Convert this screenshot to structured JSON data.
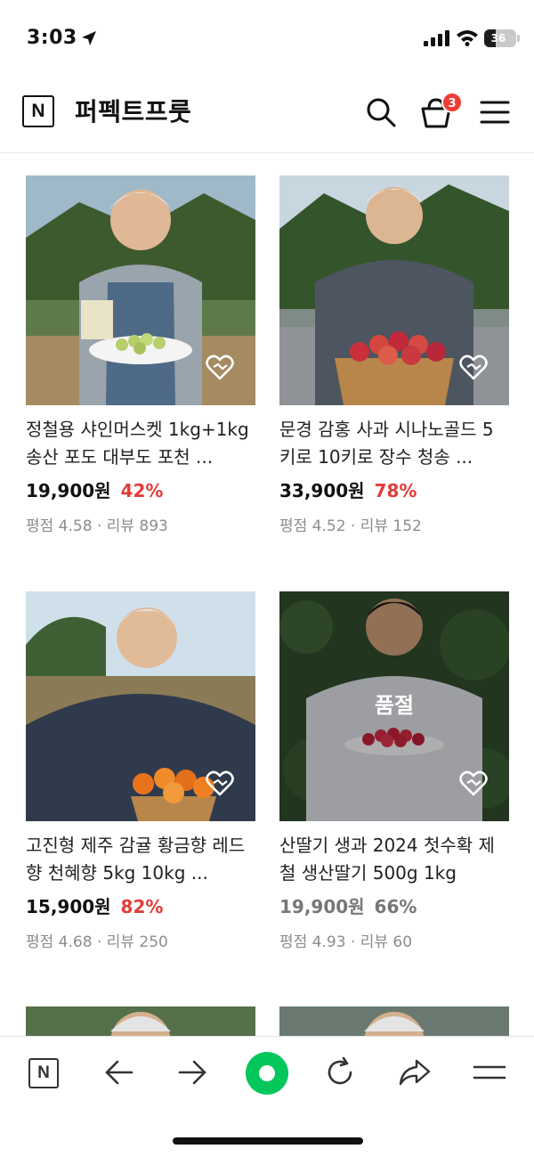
{
  "status_bar": {
    "time": "3:03",
    "battery": "36",
    "battery_level": 0.36
  },
  "header": {
    "logo": "N",
    "store_name": "퍼펙트프룻",
    "cart_count": "3"
  },
  "products": [
    {
      "title": "정철용 샤인머스켓 1kg+1kg 송산 포도 대부도 포천 ...",
      "price": "19,900원",
      "discount": "42%",
      "rating_review": "평점 4.58 · 리뷰 893",
      "sold_out": false
    },
    {
      "title": "문경 감홍 사과 시나노골드 5키로 10키로 장수 청송 ...",
      "price": "33,900원",
      "discount": "78%",
      "rating_review": "평점 4.52 · 리뷰 152",
      "sold_out": false
    },
    {
      "title": "고진형 제주 감귤 황금향 레드향 천혜향 5kg 10kg ...",
      "price": "15,900원",
      "discount": "82%",
      "rating_review": "평점 4.68 · 리뷰 250",
      "sold_out": false
    },
    {
      "title": "산딸기 생과 2024 첫수확 제철 생산딸기 500g 1kg",
      "price": "19,900원",
      "discount": "66%",
      "rating_review": "평점 4.93 · 리뷰 60",
      "sold_out": true,
      "sold_out_label": "품절"
    }
  ],
  "bottom_bar": {
    "logo": "N"
  },
  "icons": [
    "location-arrow-icon",
    "signal-icon",
    "wifi-icon",
    "battery-icon",
    "search-icon",
    "cart-icon",
    "menu-icon",
    "heart-icon",
    "back-arrow-icon",
    "forward-arrow-icon",
    "reload-icon",
    "share-icon"
  ],
  "colors": {
    "discount": "#e03d3a",
    "badge": "#ef3c36",
    "green_button": "#03c75a",
    "muted": "#8c8c8c"
  }
}
